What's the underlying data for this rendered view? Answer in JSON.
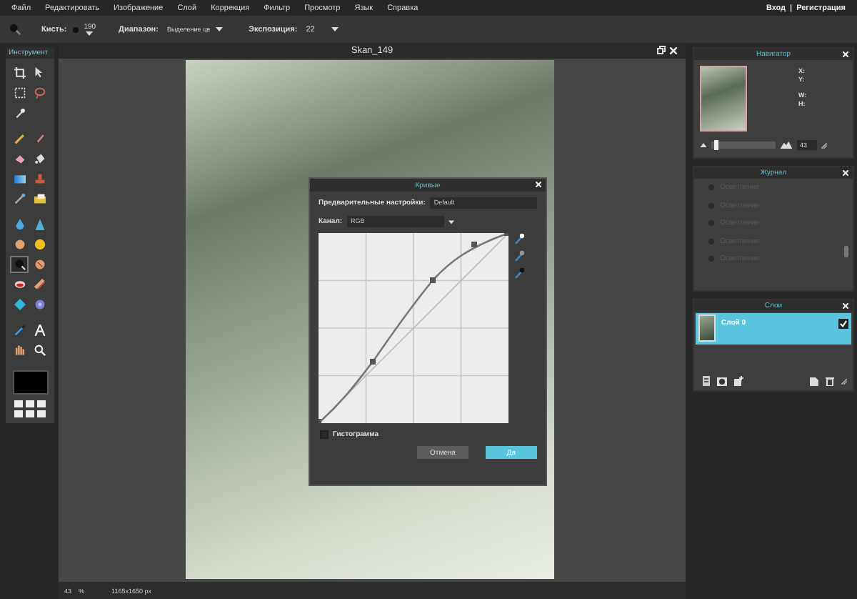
{
  "menu": {
    "items": [
      "Файл",
      "Редактировать",
      "Изображение",
      "Слой",
      "Коррекция",
      "Фильтр",
      "Просмотр",
      "Язык",
      "Справка"
    ],
    "login": "Вход",
    "separator": "|",
    "register": "Регистрация"
  },
  "options_bar": {
    "brush_label": "Кисть:",
    "brush_size": "190",
    "range_label": "Диапазон:",
    "range_value": "Выделение цв",
    "exposure_label": "Экспозиция:",
    "exposure_value": "22"
  },
  "tools_panel": {
    "title": "Инструмент",
    "groups": [
      {
        "tools": [
          {
            "selected": false
          },
          {
            "selected": false
          },
          {
            "selected": false
          },
          {
            "selected": false
          },
          {
            "selected": false
          }
        ]
      },
      {
        "tools": [
          {
            "selected": false
          },
          {
            "selected": false
          },
          {
            "selected": false
          },
          {
            "selected": false
          },
          {
            "selected": false
          },
          {
            "selected": false
          },
          {
            "selected": false
          },
          {
            "selected": false
          }
        ]
      },
      {
        "tools": [
          {
            "selected": false
          },
          {
            "selected": false
          },
          {
            "selected": false
          },
          {
            "selected": false
          },
          {
            "selected": true
          },
          {
            "selected": false
          },
          {
            "selected": false
          },
          {
            "selected": false
          },
          {
            "selected": false
          },
          {
            "selected": false
          }
        ]
      },
      {
        "tools": [
          {
            "selected": false
          },
          {
            "selected": false
          },
          {
            "selected": false
          },
          {
            "selected": false
          }
        ]
      }
    ]
  },
  "document": {
    "title": "Skan_149",
    "zoom": "43",
    "zoom_unit": "%",
    "size": "1165x1650 px"
  },
  "dialog": {
    "title": "Кривые",
    "preset_label": "Предварительные настройки:",
    "preset_value": "Default",
    "channel_label": "Канал:",
    "channel_value": "RGB",
    "histogram": {
      "label": "Гистограмма",
      "checked": false
    },
    "buttons": [
      {
        "label": "Отмена",
        "primary": false
      },
      {
        "label": "Да",
        "primary": true
      }
    ]
  },
  "navigator": {
    "title": "Навигатор",
    "x_label": "X:",
    "y_label": "Y:",
    "w_label": "W:",
    "h_label": "H:",
    "zoom": {
      "level": 0.05
    },
    "zoom_value": "43"
  },
  "history": {
    "title": "Журнал",
    "items": [
      "Осветление",
      "Осветление",
      "Осветление",
      "Осветление",
      "Осветление"
    ]
  },
  "layers": {
    "title": "Слои",
    "items": [
      {
        "name": "Слой 0",
        "selected": true,
        "visible": true
      }
    ]
  }
}
